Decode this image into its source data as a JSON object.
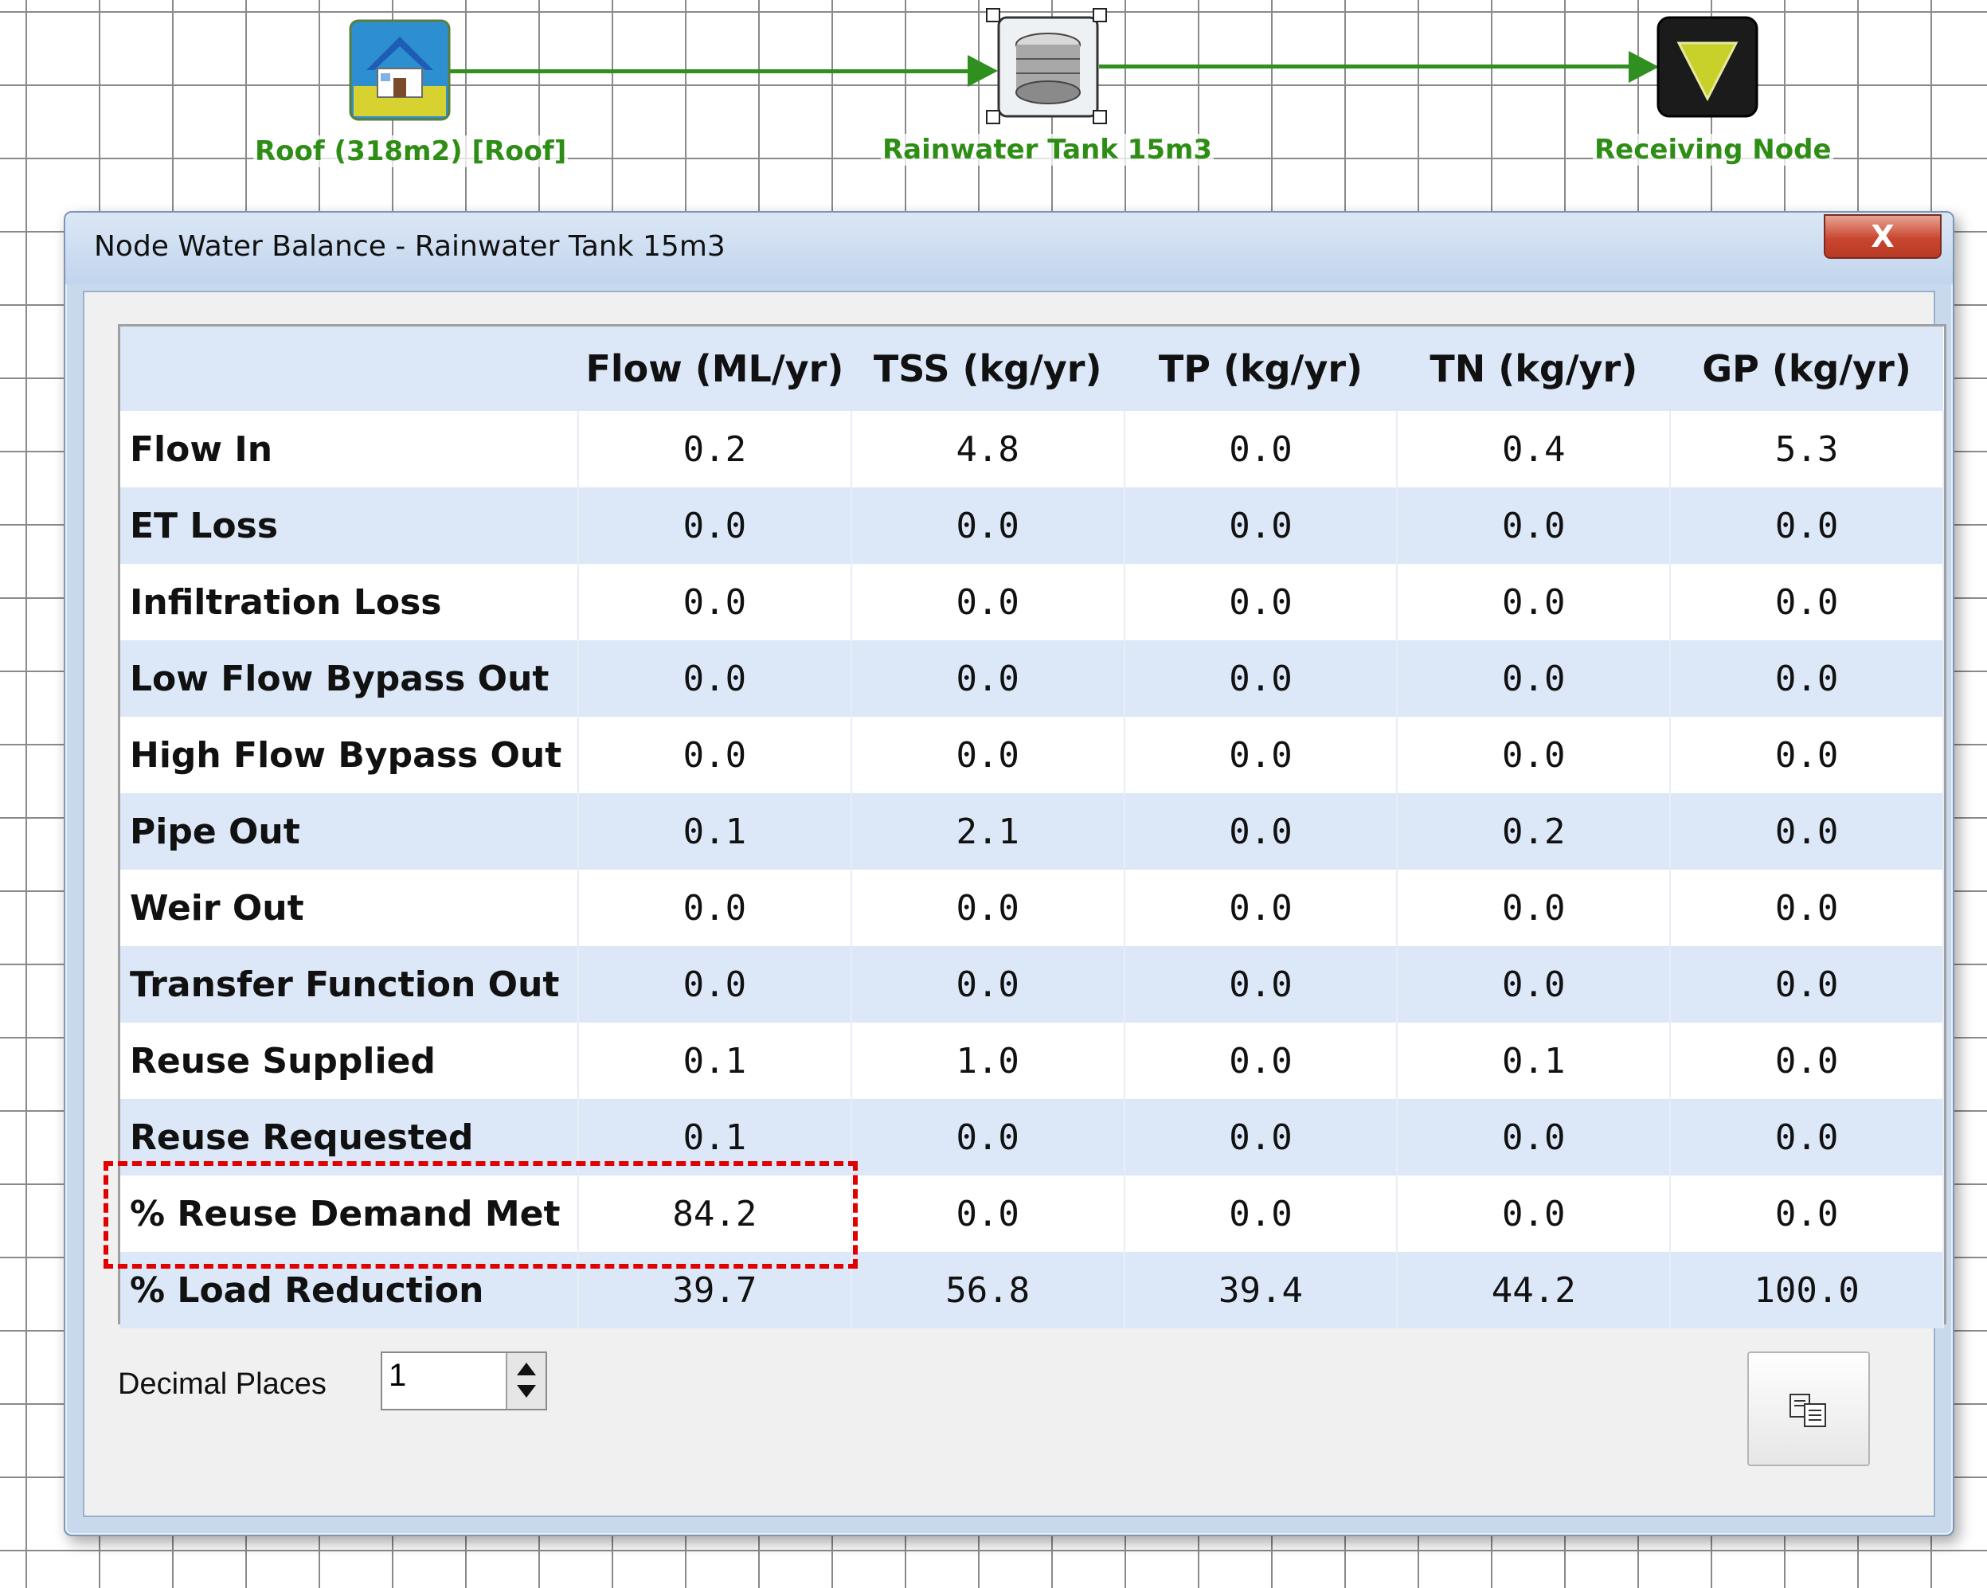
{
  "canvas": {
    "nodes": [
      {
        "label": "Roof (318m2) [Roof]",
        "icon": "house-icon"
      },
      {
        "label": "Rainwater Tank 15m3",
        "icon": "tank-icon"
      },
      {
        "label": "Receiving Node",
        "icon": "receiving-node-icon"
      }
    ],
    "link_color": "#2f8f1f"
  },
  "dialog": {
    "title": "Node Water Balance - Rainwater Tank 15m3",
    "close_label": "X",
    "table": {
      "headers": [
        "",
        "Flow (ML/yr)",
        "TSS (kg/yr)",
        "TP (kg/yr)",
        "TN (kg/yr)",
        "GP (kg/yr)"
      ],
      "rows": [
        [
          "Flow In",
          "0.2",
          "4.8",
          "0.0",
          "0.4",
          "5.3"
        ],
        [
          "ET Loss",
          "0.0",
          "0.0",
          "0.0",
          "0.0",
          "0.0"
        ],
        [
          "Infiltration Loss",
          "0.0",
          "0.0",
          "0.0",
          "0.0",
          "0.0"
        ],
        [
          "Low Flow Bypass Out",
          "0.0",
          "0.0",
          "0.0",
          "0.0",
          "0.0"
        ],
        [
          "High Flow Bypass Out",
          "0.0",
          "0.0",
          "0.0",
          "0.0",
          "0.0"
        ],
        [
          "Pipe Out",
          "0.1",
          "2.1",
          "0.0",
          "0.2",
          "0.0"
        ],
        [
          "Weir Out",
          "0.0",
          "0.0",
          "0.0",
          "0.0",
          "0.0"
        ],
        [
          "Transfer Function Out",
          "0.0",
          "0.0",
          "0.0",
          "0.0",
          "0.0"
        ],
        [
          "Reuse Supplied",
          "0.1",
          "1.0",
          "0.0",
          "0.1",
          "0.0"
        ],
        [
          "Reuse Requested",
          "0.1",
          "0.0",
          "0.0",
          "0.0",
          "0.0"
        ],
        [
          "% Reuse Demand Met",
          "84.2",
          "0.0",
          "0.0",
          "0.0",
          "0.0"
        ],
        [
          "% Load Reduction",
          "39.7",
          "56.8",
          "39.4",
          "44.2",
          "100.0"
        ]
      ]
    },
    "decimal_places": {
      "label": "Decimal Places",
      "value": "1"
    },
    "copy_button": {
      "icon": "copy-icon"
    },
    "highlight_color": "#e00000"
  }
}
